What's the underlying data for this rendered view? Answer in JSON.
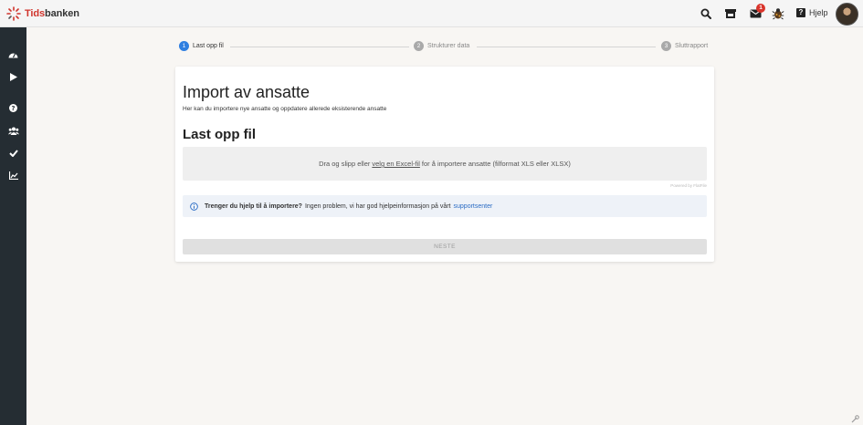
{
  "brand": {
    "name_part1": "Tids",
    "name_part2": "banken",
    "accent_color": "#d0342c"
  },
  "topbar": {
    "icons": [
      "search-icon",
      "store-icon",
      "mail-icon",
      "bug-icon"
    ],
    "mail_badge_count": "1",
    "help_glyph": "?",
    "help_label": "Hjelp"
  },
  "sidebar": {
    "items": [
      "dashboard-icon",
      "play-icon",
      "question-icon",
      "users-icon",
      "check-icon",
      "chart-icon"
    ]
  },
  "stepper": {
    "steps": [
      {
        "number": "1",
        "label": "Last opp fil",
        "active": true
      },
      {
        "number": "2",
        "label": "Strukturer data",
        "active": false
      },
      {
        "number": "3",
        "label": "Sluttrapport",
        "active": false
      }
    ],
    "active_color": "#2f7fe0"
  },
  "card": {
    "title": "Import av ansatte",
    "subtitle": "Her kan du importere nye ansatte og oppdatere allerede eksisterende ansatte",
    "section_title": "Last opp fil",
    "dropzone": {
      "text_before": "Dra og slipp eller",
      "link_text": "velg en Excel-fil",
      "text_after": "for å importere ansatte (filformat XLS eller XLSX)"
    },
    "powered_by": "Powered by FlatFile",
    "info": {
      "bold_text": "Trenger du hjelp til å importere?",
      "text": "Ingen problem, vi har god hjelpeinformasjon på vårt",
      "link_text": "supportsenter"
    },
    "next_button": "NESTE"
  }
}
